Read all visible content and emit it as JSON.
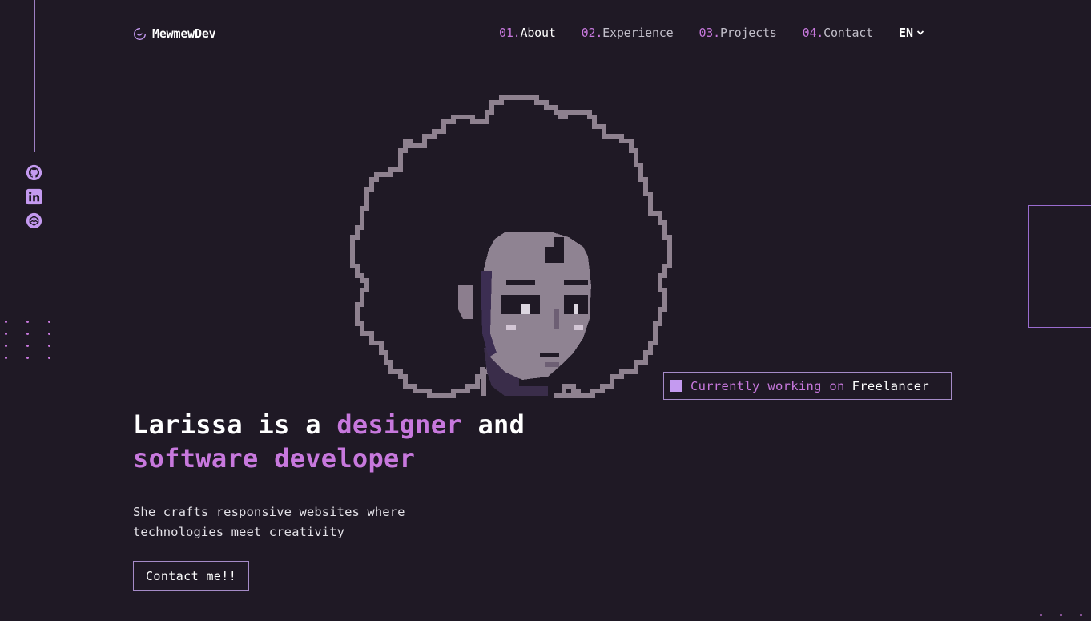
{
  "header": {
    "logo_text": "MewmewDev",
    "nav": [
      {
        "num": "01.",
        "label": "About"
      },
      {
        "num": "02.",
        "label": "Experience"
      },
      {
        "num": "03.",
        "label": "Projects"
      },
      {
        "num": "04.",
        "label": "Contact"
      }
    ],
    "language": "EN"
  },
  "social": [
    {
      "icon": "github-icon"
    },
    {
      "icon": "linkedin-icon"
    },
    {
      "icon": "codepen-icon"
    }
  ],
  "hero": {
    "headline_1": "Larissa is a ",
    "headline_accent_1": "designer",
    "headline_2": " and",
    "headline_accent_2": "software developer",
    "subtitle_line_1": "She crafts responsive websites where",
    "subtitle_line_2": "technologies meet creativity",
    "cta_label": "Contact me!!"
  },
  "status": {
    "label": "Currently working on",
    "value": "Freelancer"
  },
  "colors": {
    "background": "#1f1925",
    "accent": "#c778dd",
    "text": "#ffffff",
    "border": "#a58bc8"
  }
}
